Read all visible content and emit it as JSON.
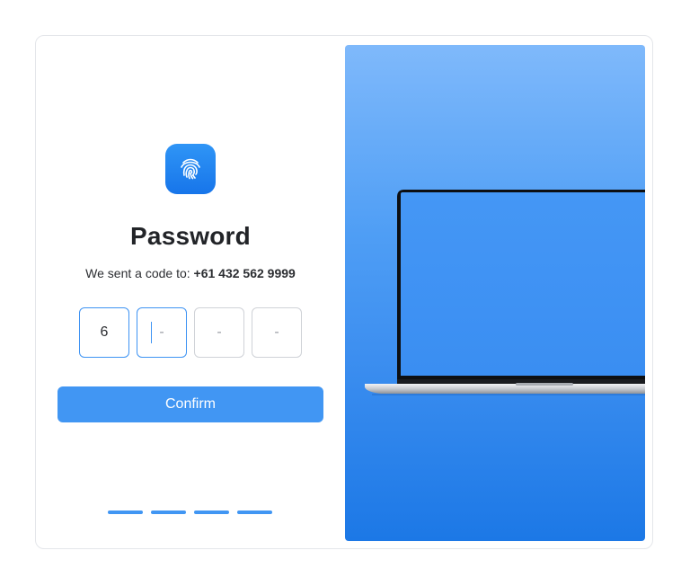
{
  "auth": {
    "icon": "fingerprint-icon",
    "title": "Password",
    "subtitle_prefix": "We sent a code to: ",
    "phone": "+61 432 562 9999",
    "code_digits": [
      {
        "value": "6",
        "state": "filled"
      },
      {
        "value": "-",
        "state": "active"
      },
      {
        "value": "-",
        "state": "empty"
      },
      {
        "value": "-",
        "state": "empty"
      }
    ],
    "confirm_label": "Confirm",
    "pager_steps": 4
  },
  "illustration": {
    "name": "laptop-illustration",
    "background": "#3d8ff0"
  },
  "colors": {
    "accent": "#4196f3",
    "text": "#222428"
  }
}
